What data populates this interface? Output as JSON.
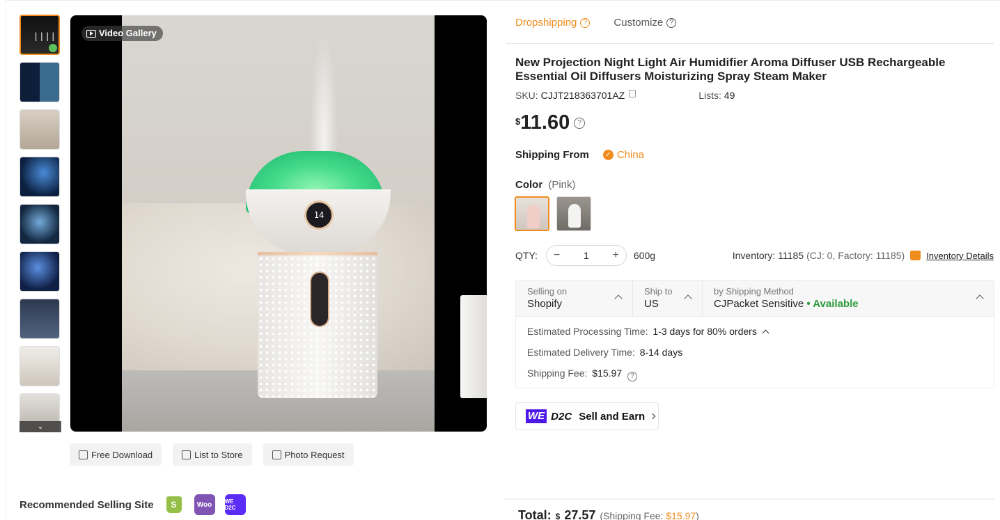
{
  "gallery": {
    "video_badge": "Video Gallery",
    "screen_digits": "14",
    "thumbnail_count": 9
  },
  "actions": {
    "free_download": "Free Download",
    "list_to_store": "List to Store",
    "photo_request": "Photo Request"
  },
  "recommended": {
    "label": "Recommended Selling Site",
    "sites": [
      "shopify-icon",
      "woocommerce-icon",
      "wed2c-icon"
    ],
    "woo_text": "Woo",
    "wed2c_text": "WE D2C"
  },
  "tabs": {
    "dropshipping": "Dropshipping",
    "customize": "Customize"
  },
  "product": {
    "title": "New Projection Night Light Air Humidifier Aroma Diffuser USB Rechargeable Essential Oil Diffusers Moisturizing Spray Steam Maker",
    "sku_label": "SKU:",
    "sku": "CJJT218363701AZ",
    "lists_label": "Lists:",
    "lists": "49",
    "currency": "$",
    "price": "11.60",
    "shipping_from_label": "Shipping From",
    "shipping_from": "China",
    "color_label": "Color",
    "color_selected": "(Pink)",
    "qty_label": "QTY:",
    "qty": "1",
    "weight": "600g",
    "inventory_label": "Inventory:",
    "inventory": "11185",
    "inventory_breakdown": "(CJ: 0, Factory: 11185)",
    "inventory_details": "Inventory Details"
  },
  "shipping": {
    "selling_on_label": "Selling on",
    "selling_on": "Shopify",
    "ship_to_label": "Ship to",
    "ship_to": "US",
    "method_label": "by Shipping Method",
    "method": "CJPacket Sensitive",
    "availability": "• Available",
    "processing_label": "Estimated Processing Time:",
    "processing": "1-3 days for 80% orders",
    "delivery_label": "Estimated Delivery Time:",
    "delivery": "8-14 days",
    "fee_label": "Shipping Fee:",
    "fee": "$15.97"
  },
  "d2c": {
    "we": "WE",
    "d2c": "D2C",
    "label": "Sell and Earn"
  },
  "total": {
    "label": "Total:",
    "currency": "$",
    "amount": "27.57",
    "fee_prefix": "(Shipping Fee:",
    "fee": "$15.97",
    "fee_suffix": ")"
  },
  "colors": {
    "accent": "#f08c1d",
    "available": "#2c9a3d",
    "woo": "#7f54b3",
    "wed2c": "#5b2cf6",
    "shopify": "#95bf47"
  }
}
